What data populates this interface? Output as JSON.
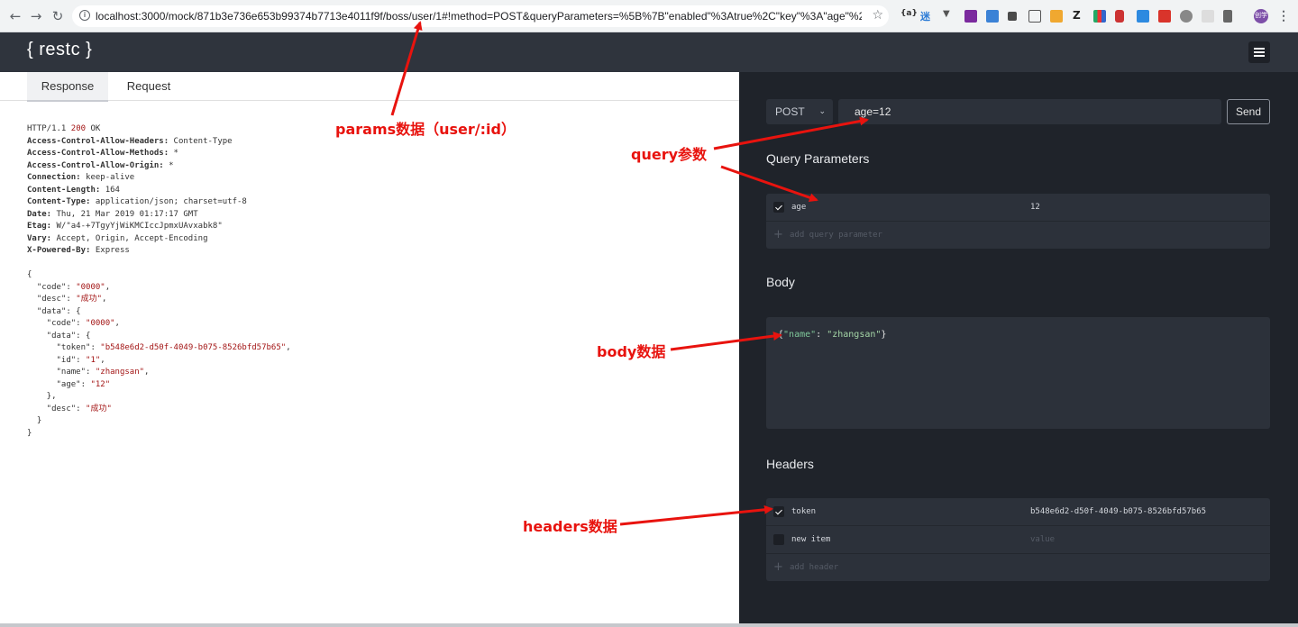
{
  "browser": {
    "url": "localhost:3000/mock/871b3e736e653b99374b7713e4011f9f/boss/user/1#!method=POST&queryParameters=%5B%7B\"enabled\"%3Atrue%2C\"key\"%3A\"age\"%2C\"value\"...",
    "back_icon": "←",
    "forward_icon": "→",
    "reload_icon": "↻",
    "info_icon": "i",
    "star_icon": "☆",
    "profile_label": "创学",
    "menu_icon": "⋮",
    "ext_labels": [
      "{a}",
      "迷",
      "▼",
      "Z"
    ]
  },
  "app": {
    "logo": "{ restc }"
  },
  "left": {
    "tabs": [
      "Response",
      "Request"
    ],
    "response_lines": [
      {
        "k": "",
        "v": "HTTP/1.1 ",
        "status": "200",
        "tail": " OK"
      },
      {
        "k": "Access-Control-Allow-Headers:",
        "v": " Content-Type"
      },
      {
        "k": "Access-Control-Allow-Methods:",
        "v": " *"
      },
      {
        "k": "Access-Control-Allow-Origin:",
        "v": " *"
      },
      {
        "k": "Connection:",
        "v": " keep-alive"
      },
      {
        "k": "Content-Length:",
        "v": " 164"
      },
      {
        "k": "Content-Type:",
        "v": " application/json; charset=utf-8"
      },
      {
        "k": "Date:",
        "v": " Thu, 21 Mar 2019 01:17:17 GMT"
      },
      {
        "k": "Etag:",
        "v": " W/\"a4-+7TgyYjWiKMCIccJpmxUAvxabk8\""
      },
      {
        "k": "Vary:",
        "v": " Accept, Origin, Accept-Encoding"
      },
      {
        "k": "X-Powered-By:",
        "v": " Express"
      }
    ],
    "json_lines": [
      {
        "pre": "{",
        "s": "",
        "post": ""
      },
      {
        "pre": "  \"code\": ",
        "s": "\"0000\"",
        "post": ","
      },
      {
        "pre": "  \"desc\": ",
        "s": "\"成功\"",
        "post": ","
      },
      {
        "pre": "  \"data\": {",
        "s": "",
        "post": ""
      },
      {
        "pre": "    \"code\": ",
        "s": "\"0000\"",
        "post": ","
      },
      {
        "pre": "    \"data\": {",
        "s": "",
        "post": ""
      },
      {
        "pre": "      \"token\": ",
        "s": "\"b548e6d2-d50f-4049-b075-8526bfd57b65\"",
        "post": ","
      },
      {
        "pre": "      \"id\": ",
        "s": "\"1\"",
        "post": ","
      },
      {
        "pre": "      \"name\": ",
        "s": "\"zhangsan\"",
        "post": ","
      },
      {
        "pre": "      \"age\": ",
        "s": "\"12\"",
        "post": ""
      },
      {
        "pre": "    },",
        "s": "",
        "post": ""
      },
      {
        "pre": "    \"desc\": ",
        "s": "\"成功\"",
        "post": ""
      },
      {
        "pre": "  }",
        "s": "",
        "post": ""
      },
      {
        "pre": "}",
        "s": "",
        "post": ""
      }
    ]
  },
  "right": {
    "method": "POST",
    "chevron_icon": "⌄",
    "url_value": "age=12",
    "send_label": "Send",
    "query_title": "Query Parameters",
    "query_params": [
      {
        "enabled": true,
        "key": "age",
        "value": "12"
      }
    ],
    "add_query_label": "add query parameter",
    "plus_icon": "+",
    "body_title": "Body",
    "body": {
      "open": "{",
      "key": "\"name\"",
      "sep": ": ",
      "value": "\"zhangsan\"",
      "close": "}"
    },
    "headers_title": "Headers",
    "headers": [
      {
        "enabled": true,
        "key": "token",
        "value": "b548e6d2-d50f-4049-b075-8526bfd57b65"
      }
    ],
    "new_item": {
      "key": "new item",
      "value_placeholder": "value"
    },
    "add_header_label": "add header"
  },
  "annotations": {
    "params": "params数据（user/:id）",
    "query": "query参数",
    "body": "body数据",
    "headers": "headers数据"
  },
  "colors": {
    "annotation": "#e8130e",
    "panel_dark": "#1f232a",
    "header_dark": "#2f343d"
  }
}
